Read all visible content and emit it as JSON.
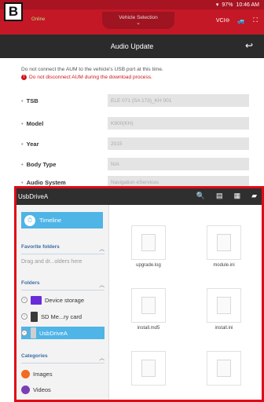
{
  "badge": "B",
  "status": {
    "signal": "▾",
    "battery": "97%",
    "time": "10:46 AM"
  },
  "app": {
    "status": "Online",
    "center_label": "Vehicle Selection",
    "vci": "VCI"
  },
  "screen": {
    "title": "Audio Update"
  },
  "warnings": {
    "line1": "Do not connect the AUM to the vehicle's USB port at this time.",
    "line2": "Do not disconnect AUM during the download process."
  },
  "fields": [
    {
      "label": "TSB",
      "value": "ELE 071 (SA 173)_KH 001"
    },
    {
      "label": "Model",
      "value": "K900(KH)"
    },
    {
      "label": "Year",
      "value": "2015"
    },
    {
      "label": "Body Type",
      "value": "N/A"
    },
    {
      "label": "Audio System",
      "value": "Navigation eServices"
    }
  ],
  "file_manager": {
    "title": "UsbDriveA",
    "timeline": "Timeline",
    "favorites_header": "Favorite folders",
    "drag_hint": "Drag and dr...olders here",
    "folders_header": "Folders",
    "folders": [
      {
        "label": "Device storage",
        "color": "#6a2bd9"
      },
      {
        "label": "SD Me...ry card",
        "color": "#3a3a3a"
      },
      {
        "label": "UsbDriveA",
        "color": "#cfcfcf",
        "selected": true
      }
    ],
    "categories_header": "Categories",
    "categories": [
      {
        "label": "Images",
        "color": "#f26b21"
      },
      {
        "label": "Videos",
        "color": "#7b3fb3"
      }
    ],
    "files": [
      "upgrade.log",
      "module.ini",
      "install.md5",
      "install.ini",
      "",
      ""
    ]
  },
  "colors": {
    "accent_red": "#c41827",
    "selection_blue": "#4fb4e6",
    "highlight_border": "#e00a16"
  }
}
